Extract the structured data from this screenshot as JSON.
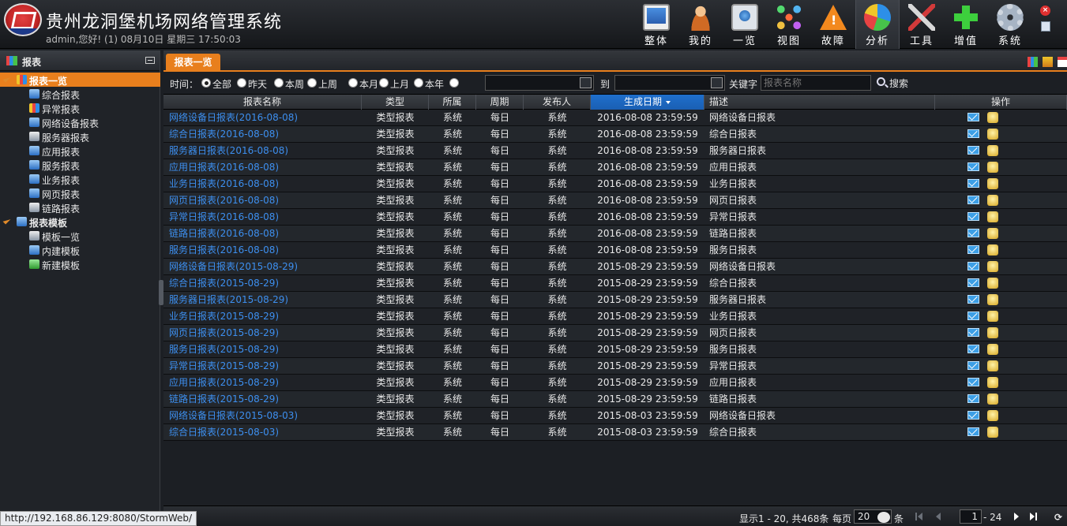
{
  "header": {
    "app_title": "贵州龙洞堡机场网络管理系统",
    "user_line": "admin,您好! (1) 08月10日 星期三 17:50:03",
    "nav": [
      {
        "label": "整体",
        "icon": "monitor-icon"
      },
      {
        "label": "我的",
        "icon": "person-icon"
      },
      {
        "label": "一览",
        "icon": "list-icon"
      },
      {
        "label": "视图",
        "icon": "topology-icon"
      },
      {
        "label": "故障",
        "icon": "warning-icon"
      },
      {
        "label": "分析",
        "icon": "pie-chart-icon",
        "active": true
      },
      {
        "label": "工具",
        "icon": "tools-icon"
      },
      {
        "label": "增值",
        "icon": "plus-icon"
      },
      {
        "label": "系统",
        "icon": "gear-icon"
      }
    ]
  },
  "sidebar": {
    "title": "报表",
    "tree": [
      {
        "label": "报表一览",
        "root": true,
        "selected": true,
        "icon": "ico-bar"
      },
      {
        "label": "综合报表",
        "icon": "ico-blue"
      },
      {
        "label": "异常报表",
        "icon": "ico-bar"
      },
      {
        "label": "网络设备报表",
        "icon": "ico-blue"
      },
      {
        "label": "服务器报表",
        "icon": "ico-gray"
      },
      {
        "label": "应用报表",
        "icon": "ico-blue"
      },
      {
        "label": "服务报表",
        "icon": "ico-blue"
      },
      {
        "label": "业务报表",
        "icon": "ico-blue"
      },
      {
        "label": "网页报表",
        "icon": "ico-blue"
      },
      {
        "label": "链路报表",
        "icon": "ico-gray"
      },
      {
        "label": "报表模板",
        "root": true,
        "icon": "ico-blue"
      },
      {
        "label": "模板一览",
        "icon": "ico-gray"
      },
      {
        "label": "内建模板",
        "icon": "ico-blue"
      },
      {
        "label": "新建模板",
        "icon": "ico-green"
      }
    ]
  },
  "main": {
    "tab_label": "报表一览",
    "filter": {
      "time_label": "时间：",
      "options": [
        "全部",
        "昨天",
        "本周",
        "上周",
        "本月",
        "上月",
        "本年"
      ],
      "selected": "全部",
      "to_label": "到",
      "keyword_label": "关键字",
      "keyword_placeholder": "报表名称",
      "search_label": "搜索"
    },
    "columns": [
      "报表名称",
      "类型",
      "所属",
      "周期",
      "发布人",
      "生成日期",
      "描述",
      "操作"
    ],
    "sorted_column": "生成日期",
    "rows": [
      {
        "name": "网络设备日报表(2016-08-08)",
        "type": "类型报表",
        "owner": "系统",
        "period": "每日",
        "publisher": "系统",
        "date": "2016-08-08 23:59:59",
        "desc": "网络设备日报表"
      },
      {
        "name": "综合日报表(2016-08-08)",
        "type": "类型报表",
        "owner": "系统",
        "period": "每日",
        "publisher": "系统",
        "date": "2016-08-08 23:59:59",
        "desc": "综合日报表"
      },
      {
        "name": "服务器日报表(2016-08-08)",
        "type": "类型报表",
        "owner": "系统",
        "period": "每日",
        "publisher": "系统",
        "date": "2016-08-08 23:59:59",
        "desc": "服务器日报表"
      },
      {
        "name": "应用日报表(2016-08-08)",
        "type": "类型报表",
        "owner": "系统",
        "period": "每日",
        "publisher": "系统",
        "date": "2016-08-08 23:59:59",
        "desc": "应用日报表"
      },
      {
        "name": "业务日报表(2016-08-08)",
        "type": "类型报表",
        "owner": "系统",
        "period": "每日",
        "publisher": "系统",
        "date": "2016-08-08 23:59:59",
        "desc": "业务日报表"
      },
      {
        "name": "网页日报表(2016-08-08)",
        "type": "类型报表",
        "owner": "系统",
        "period": "每日",
        "publisher": "系统",
        "date": "2016-08-08 23:59:59",
        "desc": "网页日报表"
      },
      {
        "name": "异常日报表(2016-08-08)",
        "type": "类型报表",
        "owner": "系统",
        "period": "每日",
        "publisher": "系统",
        "date": "2016-08-08 23:59:59",
        "desc": "异常日报表"
      },
      {
        "name": "链路日报表(2016-08-08)",
        "type": "类型报表",
        "owner": "系统",
        "period": "每日",
        "publisher": "系统",
        "date": "2016-08-08 23:59:59",
        "desc": "链路日报表"
      },
      {
        "name": "服务日报表(2016-08-08)",
        "type": "类型报表",
        "owner": "系统",
        "period": "每日",
        "publisher": "系统",
        "date": "2016-08-08 23:59:59",
        "desc": "服务日报表"
      },
      {
        "name": "网络设备日报表(2015-08-29)",
        "type": "类型报表",
        "owner": "系统",
        "period": "每日",
        "publisher": "系统",
        "date": "2015-08-29 23:59:59",
        "desc": "网络设备日报表"
      },
      {
        "name": "综合日报表(2015-08-29)",
        "type": "类型报表",
        "owner": "系统",
        "period": "每日",
        "publisher": "系统",
        "date": "2015-08-29 23:59:59",
        "desc": "综合日报表"
      },
      {
        "name": "服务器日报表(2015-08-29)",
        "type": "类型报表",
        "owner": "系统",
        "period": "每日",
        "publisher": "系统",
        "date": "2015-08-29 23:59:59",
        "desc": "服务器日报表"
      },
      {
        "name": "业务日报表(2015-08-29)",
        "type": "类型报表",
        "owner": "系统",
        "period": "每日",
        "publisher": "系统",
        "date": "2015-08-29 23:59:59",
        "desc": "业务日报表"
      },
      {
        "name": "网页日报表(2015-08-29)",
        "type": "类型报表",
        "owner": "系统",
        "period": "每日",
        "publisher": "系统",
        "date": "2015-08-29 23:59:59",
        "desc": "网页日报表"
      },
      {
        "name": "服务日报表(2015-08-29)",
        "type": "类型报表",
        "owner": "系统",
        "period": "每日",
        "publisher": "系统",
        "date": "2015-08-29 23:59:59",
        "desc": "服务日报表"
      },
      {
        "name": "异常日报表(2015-08-29)",
        "type": "类型报表",
        "owner": "系统",
        "period": "每日",
        "publisher": "系统",
        "date": "2015-08-29 23:59:59",
        "desc": "异常日报表"
      },
      {
        "name": "应用日报表(2015-08-29)",
        "type": "类型报表",
        "owner": "系统",
        "period": "每日",
        "publisher": "系统",
        "date": "2015-08-29 23:59:59",
        "desc": "应用日报表"
      },
      {
        "name": "链路日报表(2015-08-29)",
        "type": "类型报表",
        "owner": "系统",
        "period": "每日",
        "publisher": "系统",
        "date": "2015-08-29 23:59:59",
        "desc": "链路日报表"
      },
      {
        "name": "网络设备日报表(2015-08-03)",
        "type": "类型报表",
        "owner": "系统",
        "period": "每日",
        "publisher": "系统",
        "date": "2015-08-03 23:59:59",
        "desc": "网络设备日报表"
      },
      {
        "name": "综合日报表(2015-08-03)",
        "type": "类型报表",
        "owner": "系统",
        "period": "每日",
        "publisher": "系统",
        "date": "2015-08-03 23:59:59",
        "desc": "综合日报表"
      }
    ]
  },
  "pager": {
    "summary": "显示1 - 20, 共468条",
    "per_page_label": "每页",
    "per_page_value": "20",
    "per_page_unit": "条",
    "current_page": "1",
    "total_pages_text": "- 24"
  },
  "statusbar": {
    "url": "http://192.168.86.129:8080/StormWeb/"
  },
  "colors": {
    "accent": "#e87f1d",
    "link": "#3d8fef",
    "sorted_header": "#1f6fcc",
    "background": "#1c1f24"
  }
}
